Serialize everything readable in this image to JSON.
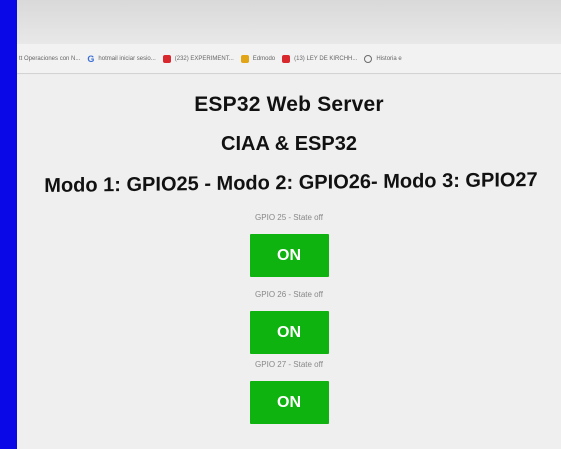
{
  "browser": {
    "bookmarks": [
      {
        "icon": "text-fragment-icon",
        "label": "tt  Operaciones con N..."
      },
      {
        "icon": "google-icon",
        "label": "hotmail iniciar sesio..."
      },
      {
        "icon": "youtube-icon",
        "label": "(232) EXPERIMENT..."
      },
      {
        "icon": "edmodo-icon",
        "label": "Edmodo"
      },
      {
        "icon": "youtube-icon",
        "label": "(13) LEY DE KIRCHH..."
      },
      {
        "icon": "world-icon",
        "label": "Historia e"
      }
    ]
  },
  "page": {
    "title": "ESP32 Web Server",
    "subtitle": "CIAA & ESP32",
    "modes": "Modo 1: GPIO25 - Modo 2: GPIO26- Modo 3: GPIO27",
    "gpios": [
      {
        "state_text": "GPIO 25 - State off",
        "button_label": "ON"
      },
      {
        "state_text": "GPIO 26 - State off",
        "button_label": "ON"
      },
      {
        "state_text": "GPIO 27 - State off",
        "button_label": "ON"
      }
    ]
  },
  "colors": {
    "frame_blue": "#0b08e8",
    "button_green": "#0eb30f",
    "background": "#efefef"
  }
}
